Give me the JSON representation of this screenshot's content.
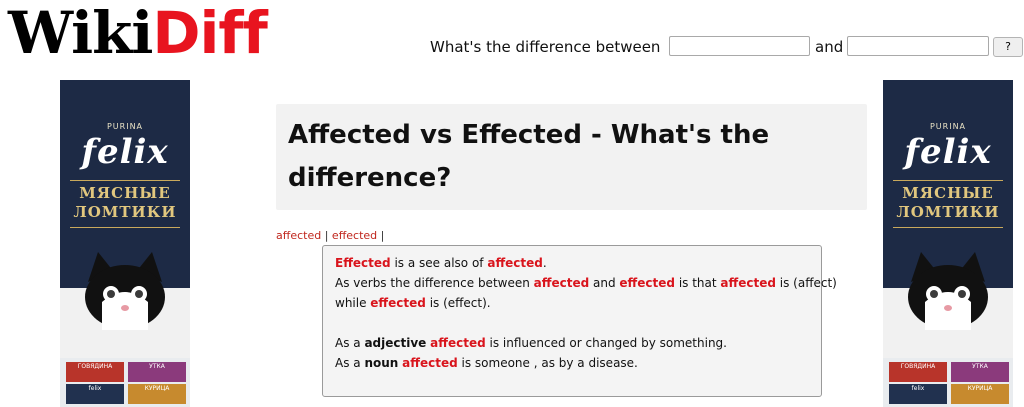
{
  "logo": {
    "part1": "Wiki",
    "part2": "Diff"
  },
  "compare": {
    "label": "What's the difference between",
    "and": "and",
    "input1_value": "",
    "input2_value": "",
    "button": "?"
  },
  "ad": {
    "maker": "PURINA",
    "brand": "felix",
    "tagline_line1": "МЯСНЫЕ",
    "tagline_line2": "ЛОМТИКИ",
    "pack1": "ГОВЯДИНА",
    "pack2": "УТКА",
    "pack3": "felix",
    "pack4": "КУРИЦА"
  },
  "title": "Affected vs Effected - What's the difference?",
  "wordlinks": {
    "w1": "affected",
    "sep1": "|",
    "w2": "effected",
    "sep2": "|"
  },
  "definition": {
    "l1": {
      "w1": "Effected",
      "t1": " is a see also of ",
      "w2": "affected",
      "t2": "."
    },
    "l2": {
      "t1": "As verbs the difference between ",
      "w1": "affected",
      "t2": " and ",
      "w2": "effected",
      "t3": " is that ",
      "w3": "affected",
      "t4": " is (affect)"
    },
    "l3": {
      "t1": "while ",
      "w1": "effected",
      "t2": " is (effect)."
    },
    "l4": {
      "t1": "As a ",
      "pos": "adjective",
      "t2": " ",
      "w1": "affected",
      "t3": " is influenced or changed by something."
    },
    "l5": {
      "t1": "As a ",
      "pos": "noun",
      "t2": " ",
      "w1": "affected",
      "t3": " is someone , as by a disease."
    }
  }
}
